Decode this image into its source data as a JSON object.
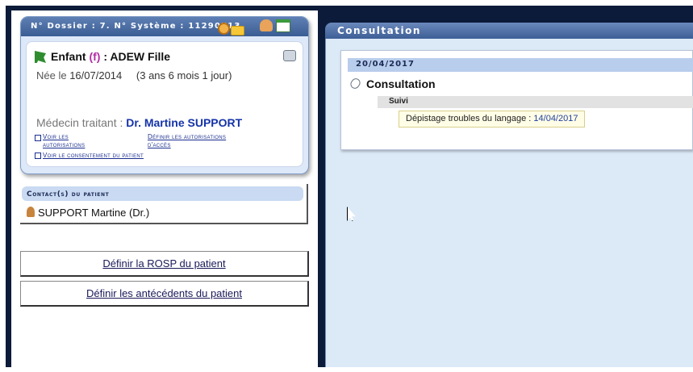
{
  "patient_card": {
    "header": "N° Dossier : 7.  N° Système : 11290713.",
    "icons": [
      "alarm-clock-icon",
      "folder-icon",
      "people-icon",
      "calendar-icon"
    ],
    "name_prefix": "Enfant",
    "sex": "(f)",
    "name": ": ADEW Fille",
    "birth_label": "Née le",
    "birth_date": "16/07/2014",
    "age": "(3 ans 6 mois 1 jour)",
    "doctor_label": "Médecin traitant :",
    "doctor_name": "Dr. Martine SUPPORT",
    "links": {
      "view_authorizations_1": "Voir les",
      "view_authorizations_2": "autorisations",
      "define_access_1": "Définir les autorisations",
      "define_access_2": "d'accès",
      "view_consent": "Voir le consentement du patient"
    }
  },
  "contacts": {
    "title": "Contact(s) du patient",
    "items": [
      "SUPPORT Martine (Dr.)"
    ]
  },
  "buttons": {
    "rosp": "Définir la ROSP du patient",
    "antecedents": "Définir les antécédents du patient"
  },
  "consultation": {
    "header": "Consultation",
    "date": "20/04/2017",
    "title": "Consultation",
    "section": "Suivi",
    "item_label": "Dépistage troubles du langage :",
    "item_value": "14/04/2017"
  },
  "colors": {
    "frame": "#0b1b39",
    "header_blue": "#3a5d94",
    "doctor_blue": "#1533a8",
    "sex_magenta": "#b22ea4",
    "panel_bg": "#dce9f7"
  }
}
